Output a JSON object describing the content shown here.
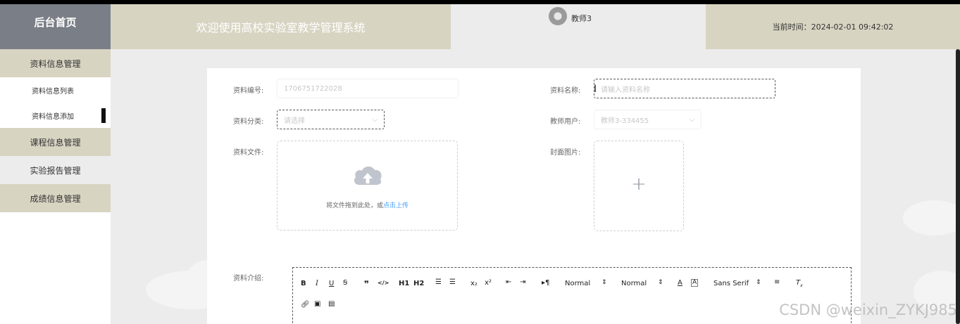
{
  "header": {
    "brand": "后台首页",
    "welcome": "欢迎使用高校实验室教学管理系统",
    "username": "教师3",
    "time": "当前时间：2024-02-01 09:42:02"
  },
  "sidebar": {
    "groups": [
      {
        "label": "资料信息管理"
      },
      {
        "label": "课程信息管理"
      },
      {
        "label": "实验报告管理"
      },
      {
        "label": "成绩信息管理"
      }
    ],
    "sub_items": [
      {
        "label": "资料信息列表"
      },
      {
        "label": "资料信息添加"
      }
    ]
  },
  "form": {
    "id_label": "资料编号:",
    "id_value": "1706751722028",
    "name_label": "资料名称:",
    "name_placeholder": "请输入资料名称",
    "category_label": "资料分类:",
    "category_placeholder": "请选择",
    "teacher_label": "教师用户:",
    "teacher_value": "教师3-334455",
    "file_label": "资料文件:",
    "upload_text": "将文件拖到此处，或",
    "upload_link": "点击上传",
    "cover_label": "封面图片:",
    "intro_label": "资料介绍:"
  },
  "editor_toolbar": {
    "header_select": "Normal",
    "size_select": "Normal",
    "font_select": "Sans Serif",
    "bold": "B",
    "italic": "I",
    "underline": "U",
    "h1": "H1",
    "h2": "H2"
  },
  "watermark": "CSDN @weixin_ZYKJ985"
}
